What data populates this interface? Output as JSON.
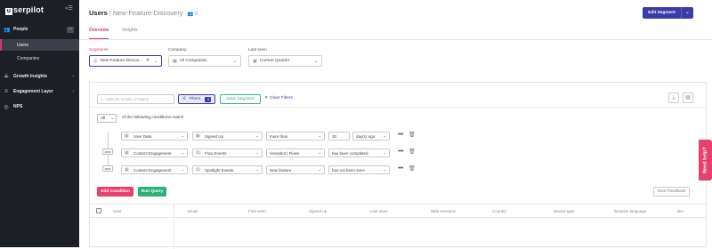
{
  "app": {
    "logo_text": "serpilot",
    "logo_letter": "u"
  },
  "sidebar": {
    "sections": [
      {
        "label": "People",
        "icon": "people-icon"
      },
      {
        "label": "Growth Insights",
        "icon": "chart-icon"
      },
      {
        "label": "Engagement Layer",
        "icon": "layers-icon"
      },
      {
        "label": "NPS",
        "icon": "nps-icon"
      }
    ],
    "people_items": [
      "Users",
      "Companies"
    ],
    "active_item": "Users"
  },
  "header": {
    "title": "Users",
    "separator": "|",
    "segment_name": "New-Feature-Discovery",
    "user_count": "0",
    "edit_button": "Edit Segment"
  },
  "tabs": [
    {
      "label": "Overview",
      "active": true
    },
    {
      "label": "Insights",
      "active": false
    }
  ],
  "filters": {
    "segments": {
      "label": "Segments",
      "value": "New-Feature-Discov..."
    },
    "company": {
      "label": "Company",
      "value": "All Companies"
    },
    "last_seen": {
      "label": "Last seen",
      "value": "Current Quarter"
    }
  },
  "toolbar": {
    "search_placeholder": "User ID, Email, or Name",
    "filters_label": "Filters",
    "filters_count": "3",
    "save_segment": "Save Segment",
    "clear_filters": "Clear Filters"
  },
  "conditions": {
    "match_mode": "All",
    "match_text": "of the following conditions match",
    "connector": "and",
    "rows": [
      {
        "category": "User Data",
        "field": "Signed Up",
        "operator": "more than",
        "value": "30",
        "unit": "day(s) ago"
      },
      {
        "category": "Content Engagement",
        "field": "Flow Events",
        "operator": "UserpIlot | Flows",
        "value": "",
        "unit": "has been completed"
      },
      {
        "category": "Content Engagement",
        "field": "Spotlight Events",
        "operator": "New feature",
        "value": "",
        "unit": "has not been seen"
      }
    ]
  },
  "actions": {
    "add_condition": "Add Condition",
    "run_query": "Run Query",
    "give_feedback": "Give Feedback"
  },
  "table": {
    "columns": [
      "User",
      "Email",
      "First seen",
      "Signed up",
      "Last seen",
      "Web sessions",
      "Country",
      "Device type",
      "Browser language",
      "Bro"
    ]
  },
  "help": {
    "label": "Need help?"
  },
  "colors": {
    "sidebar": "#1d1f26",
    "accent": "#3a3da8",
    "pink": "#d1367a",
    "green": "#2fb078"
  }
}
